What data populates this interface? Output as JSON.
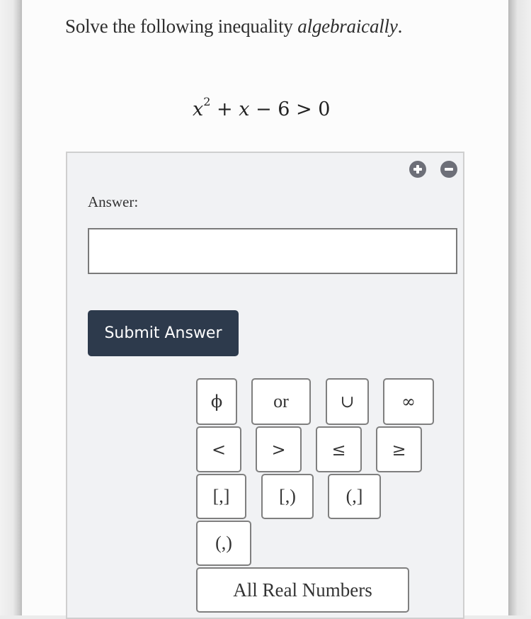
{
  "question": {
    "prompt_prefix": "Solve the following inequality ",
    "prompt_emphasis": "algebraically",
    "prompt_suffix": ".",
    "equation": {
      "var": "x",
      "exponent": "2",
      "rest_op1": " + ",
      "var2": "x",
      "rest": " − 6 > 0"
    }
  },
  "answer_panel": {
    "expand_icon": "plus-circle-icon",
    "collapse_icon": "minus-circle-icon",
    "label": "Answer:",
    "input_value": "",
    "submit_label": "Submit Answer",
    "submit_color": "#2d3a4c"
  },
  "keypad": {
    "row1": [
      "ϕ",
      "or",
      "∪",
      "∞"
    ],
    "row2": [
      "<",
      ">",
      "≤",
      "≥"
    ],
    "row3": [
      "[,]",
      "[,)",
      "(,]"
    ],
    "row4": [
      "(,)"
    ],
    "all_real": "All Real Numbers"
  }
}
